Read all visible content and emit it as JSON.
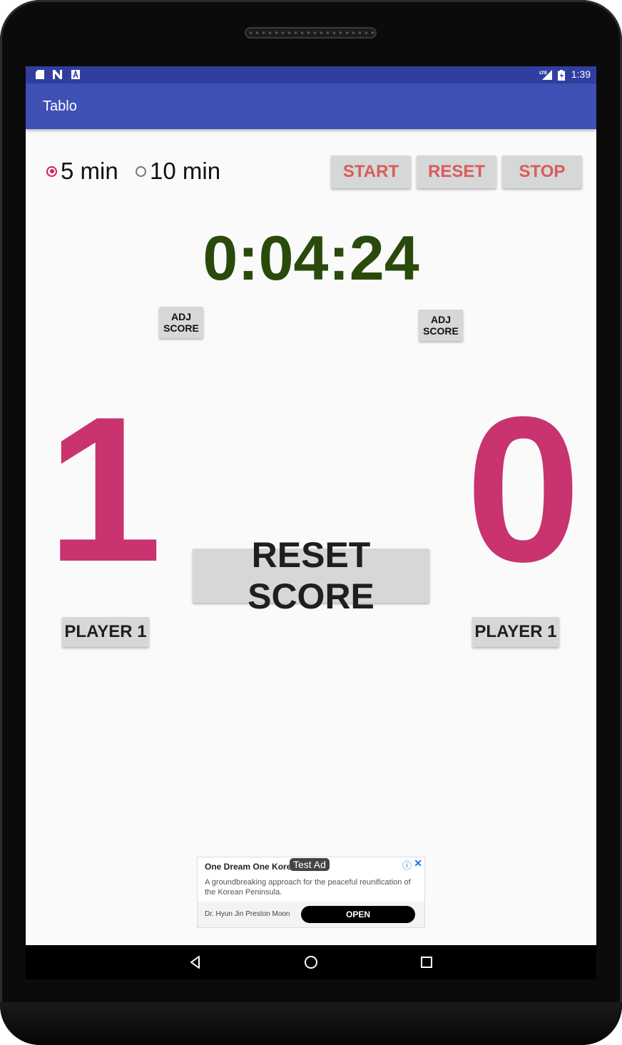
{
  "statusbar": {
    "icons": [
      "sd-card-icon",
      "n-notification-icon",
      "a-notification-icon"
    ],
    "signal_label": "LTE",
    "time": "1:39"
  },
  "appbar": {
    "title": "Tablo"
  },
  "timer_options": {
    "option_5": {
      "label": "5 min",
      "checked": true
    },
    "option_10": {
      "label": "10 min",
      "checked": false
    }
  },
  "controls": {
    "start": "START",
    "reset": "RESET",
    "stop": "STOP"
  },
  "timer": {
    "value": "0:04:24"
  },
  "adjust": {
    "left_line1": "ADJ",
    "left_line2": "SCORE",
    "right_line1": "ADJ",
    "right_line2": "SCORE"
  },
  "scores": {
    "left": "1",
    "right": "0"
  },
  "reset_score_label": "RESET SCORE",
  "players": {
    "left": "PLAYER 1",
    "right": "PLAYER 1"
  },
  "ad": {
    "title": "One Dream One Korea",
    "badge": "Test Ad",
    "description": "A groundbreaking approach for the peaceful reunification of the Korean Peninsula.",
    "advertiser": "Dr. Hyun Jin Preston Moon",
    "cta": "OPEN"
  },
  "colors": {
    "primary": "#3f51b5",
    "primary_dark": "#303f9f",
    "accent": "#d81b60",
    "score": "#c9336f",
    "timer": "#2a4a0b",
    "control_text": "#d95c5c"
  }
}
